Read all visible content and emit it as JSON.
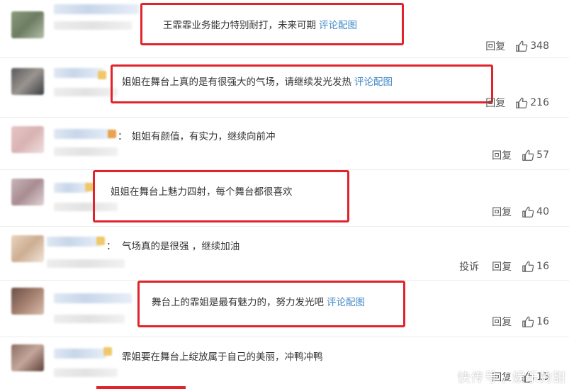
{
  "comments": [
    {
      "text": "王霏霏业务能力特别耐打，未来可期",
      "image_link": "评论配图",
      "reply": "回复",
      "likes": "348"
    },
    {
      "text": "姐姐在舞台上真的是有很强大的气场，请继续发光发热",
      "image_link": "评论配图",
      "reply": "回复",
      "likes": "216"
    },
    {
      "text": "姐姐有颜值，有实力，继续向前冲",
      "reply": "回复",
      "likes": "57"
    },
    {
      "text": "姐姐在舞台上魅力四射，每个舞台都很喜欢",
      "reply": "回复",
      "likes": "40"
    },
    {
      "text": "气场真的是很强 ，继续加油",
      "report": "投诉",
      "reply": "回复",
      "likes": "16"
    },
    {
      "text": "舞台上的霏姐是最有魅力的，努力发光吧",
      "image_link": "评论配图",
      "reply": "回复",
      "likes": "16"
    },
    {
      "text": "霏姐要在舞台上绽放属于自己的美丽，冲鸭冲鸭",
      "reply": "回复",
      "likes": "15"
    }
  ],
  "colon": "：",
  "watermark": "快传号 / 娱乐的甜",
  "colors": {
    "highlight": "#e0242b",
    "link": "#3f89c8"
  },
  "icons": {
    "like": "thumbs-up-icon"
  }
}
